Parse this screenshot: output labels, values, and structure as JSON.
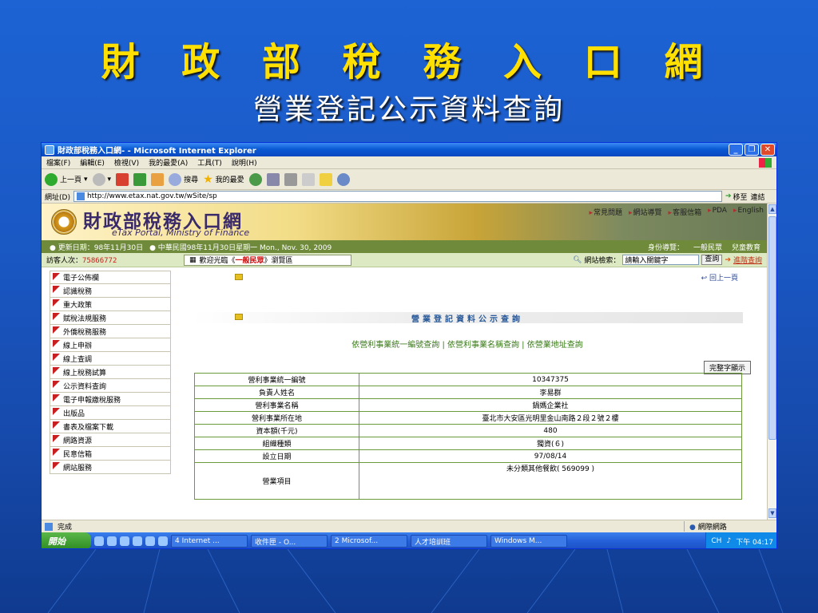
{
  "slide": {
    "title": "財 政 部 稅  務  入 口 網",
    "subtitle": "營業登記公示資料查詢"
  },
  "browser": {
    "window_title": "財政部稅務入口網- - Microsoft Internet Explorer",
    "menu": [
      "檔案(F)",
      "編輯(E)",
      "檢視(V)",
      "我的最愛(A)",
      "工具(T)",
      "說明(H)"
    ],
    "toolbar": {
      "back": "上一頁",
      "search": "搜尋",
      "favorites": "我的最愛"
    },
    "address_label": "網址(D)",
    "address_value": "http://www.etax.nat.gov.tw/wSite/sp",
    "go_label": "移至",
    "links_label": "連結",
    "status_text": "完成",
    "zone_text": "網際網路"
  },
  "site": {
    "name_zh": "財政部稅務入口網",
    "name_en": "eTax Portal, Ministry of Finance",
    "top_links": [
      "常見問題",
      "網站導覽",
      "客服信箱",
      "PDA",
      "English"
    ],
    "update_date": "更新日期：98年11月30日",
    "today_date": "中華民國98年11月30日星期一 Mon., Nov. 30, 2009",
    "identity_label": "身份導覽：",
    "identity_items": [
      "一般民眾",
      "兒童教育"
    ],
    "visitor_label": "訪客人次：",
    "visitor_count": "75866772",
    "welcome_prefix": "歡迎光臨《",
    "welcome_highlight": "一般民眾",
    "welcome_suffix": "》瀏覽區",
    "search_label": "網站檢索：",
    "search_value": "請輸入關鍵字",
    "search_button": "查詢",
    "advanced_search": "進階查詢"
  },
  "nav": [
    "電子公佈欄",
    "認識稅務",
    "重大政策",
    "賦稅法規服務",
    "外僑稅務服務",
    "線上申辦",
    "線上查調",
    "線上稅務試算",
    "公示資料查詢",
    "電子申報繳稅服務",
    "出版品",
    "書表及檔案下載",
    "網路資源",
    "民意信箱",
    "網站服務"
  ],
  "main": {
    "back_link": "回上一頁",
    "heading": "營業登記資料公示查詢",
    "query_links": [
      "依營利事業統一編號查詢",
      "依營利事業名稱查詢",
      "依營業地址查詢"
    ],
    "mode_button": "完整字顯示",
    "rows": [
      {
        "label": "營利事業統一編號",
        "value": "10347375"
      },
      {
        "label": "負責人姓名",
        "value": "李易群"
      },
      {
        "label": "營利事業名稱",
        "value": "鍋媽企業社"
      },
      {
        "label": "營利事業所在地",
        "value": "臺北市大安區光明里金山南路２段２號２樓"
      },
      {
        "label": "資本額(千元)",
        "value": "480"
      },
      {
        "label": "組織種類",
        "value": "獨資(６)"
      },
      {
        "label": "設立日期",
        "value": "97/08/14"
      }
    ],
    "business_label": "營業項目",
    "business_value": "未分類其他餐飲( 569099 )"
  },
  "taskbar": {
    "start": "開始",
    "tasks": [
      "4 Internet ...",
      "收件匣 - O...",
      "2 Microsof...",
      "人才培訓班",
      "Windows M..."
    ],
    "ime": "CH",
    "clock": "下午 04:17"
  }
}
